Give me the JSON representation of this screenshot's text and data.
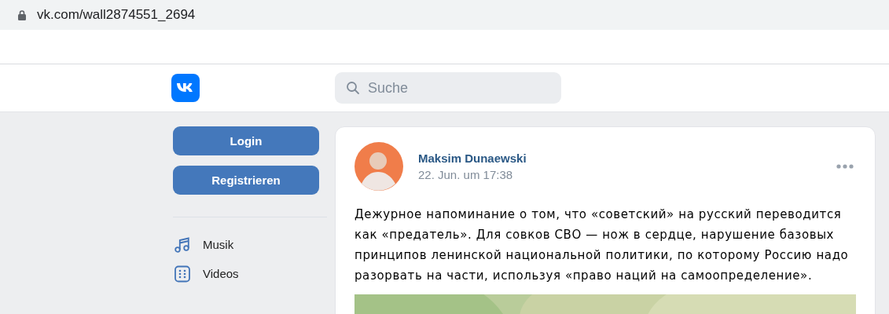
{
  "browser": {
    "url": "vk.com/wall2874551_2694"
  },
  "header": {
    "search": {
      "placeholder": "Suche"
    }
  },
  "sidebar": {
    "buttons": [
      {
        "label": "Login"
      },
      {
        "label": "Registrieren"
      }
    ],
    "items": [
      {
        "label": "Musik",
        "kind": "music"
      },
      {
        "label": "Videos",
        "kind": "video"
      }
    ]
  },
  "post": {
    "author": "Maksim Dunaewski",
    "date": "22. Jun. um 17:38",
    "text": "Дежурное напоминание о том, что «советский» на русский переводится как «предатель». Для совков СВО — нож в сердце, нарушение базовых принципов ленинской национальной политики, по которому Россию надо разорвать на части, используя «право наций на самоопределение»."
  }
}
